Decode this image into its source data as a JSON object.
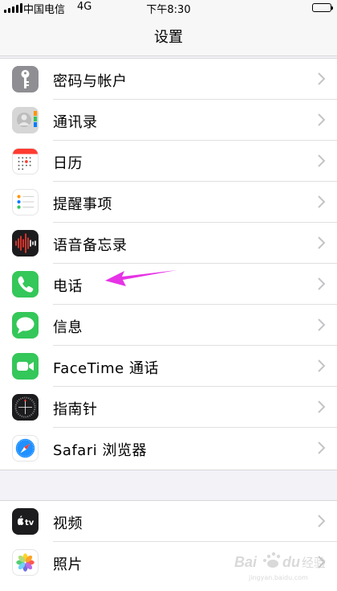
{
  "status_bar": {
    "carrier": "中国电信",
    "network": "4G",
    "time": "下午8:30"
  },
  "nav": {
    "title": "设置"
  },
  "groups": [
    {
      "items": [
        {
          "label": "密码与帐户",
          "icon": "key-icon",
          "color": "#8e8e93"
        },
        {
          "label": "通讯录",
          "icon": "contacts-icon",
          "color": "#d6d6d6"
        },
        {
          "label": "日历",
          "icon": "calendar-icon",
          "color": "#ffffff"
        },
        {
          "label": "提醒事项",
          "icon": "reminders-icon",
          "color": "#ffffff"
        },
        {
          "label": "语音备忘录",
          "icon": "voice-memos-icon",
          "color": "#1c1c1e"
        },
        {
          "label": "电话",
          "icon": "phone-icon",
          "color": "#34c759"
        },
        {
          "label": "信息",
          "icon": "messages-icon",
          "color": "#34c759"
        },
        {
          "label": "FaceTime 通话",
          "icon": "facetime-icon",
          "color": "#34c759"
        },
        {
          "label": "指南针",
          "icon": "compass-icon",
          "color": "#1c1c1e"
        },
        {
          "label": "Safari 浏览器",
          "icon": "safari-icon",
          "color": "#ffffff"
        }
      ]
    },
    {
      "items": [
        {
          "label": "视频",
          "icon": "tv-icon",
          "color": "#1c1c1e"
        },
        {
          "label": "照片",
          "icon": "photos-icon",
          "color": "#ffffff"
        }
      ]
    }
  ],
  "annotation": {
    "icon": "pointer-arrow-icon",
    "color": "#e633e6"
  },
  "watermark": {
    "text": "Baidu 经验",
    "url": "jingyan.baidu.com"
  }
}
